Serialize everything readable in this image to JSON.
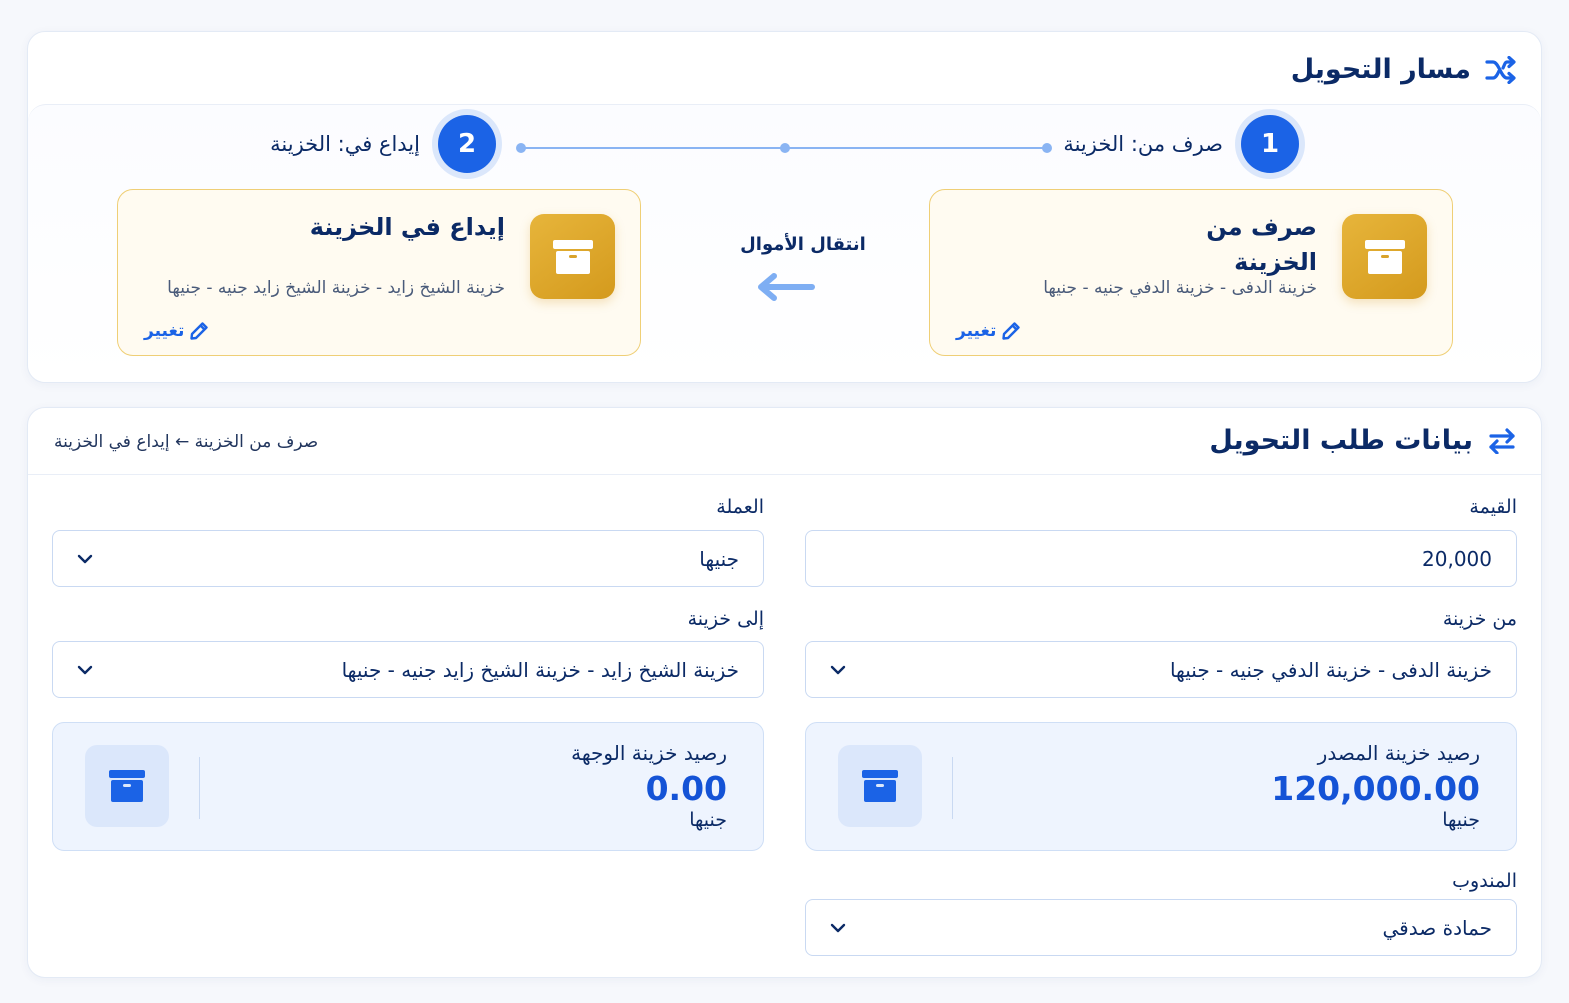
{
  "colors": {
    "primary": "#1b63e6",
    "navy": "#0b2a66",
    "gold": "#e0a92e",
    "gold_border": "#efcf76",
    "balance_bg": "#eef4fe"
  },
  "path_card": {
    "title": "مسار التحويل",
    "title_icon": "shuffle-icon",
    "steps": [
      {
        "number": "1",
        "label": "صرف من: الخزينة"
      },
      {
        "number": "2",
        "label": "إيداع في: الخزينة"
      }
    ],
    "source": {
      "title": "صرف من الخزينة",
      "description": "خزينة الدفى - خزينة الدفي جنيه - جنيها",
      "change_label": "تغيير",
      "icon": "archive-box-icon"
    },
    "destination": {
      "title": "إيداع في الخزينة",
      "description": "خزينة الشيخ زايد - خزينة الشيخ زايد جنيه - جنيها",
      "change_label": "تغيير",
      "icon": "archive-box-icon"
    },
    "flow_label": "انتقال الأموال",
    "flow_icon": "arrow-left-icon"
  },
  "data_card": {
    "title": "بيانات طلب التحويل",
    "title_icon": "swap-arrows-icon",
    "summary": "صرف من الخزينة ← إيداع في الخزينة",
    "fields": {
      "amount": {
        "label": "القيمة",
        "value": "20,000"
      },
      "currency": {
        "label": "العملة",
        "value": "جنيها"
      },
      "from_vault": {
        "label": "من خزينة",
        "value": "خزينة الدفى - خزينة الدفي جنيه - جنيها"
      },
      "to_vault": {
        "label": "إلى خزينة",
        "value": "خزينة الشيخ زايد - خزينة الشيخ زايد جنيه - جنيها"
      },
      "representative": {
        "label": "المندوب",
        "value": "حمادة صدقي"
      }
    },
    "source_balance": {
      "label": "رصيد خزينة المصدر",
      "amount": "120,000.00",
      "currency": "جنيها"
    },
    "destination_balance": {
      "label": "رصيد خزينة الوجهة",
      "amount": "0.00",
      "currency": "جنيها"
    }
  }
}
